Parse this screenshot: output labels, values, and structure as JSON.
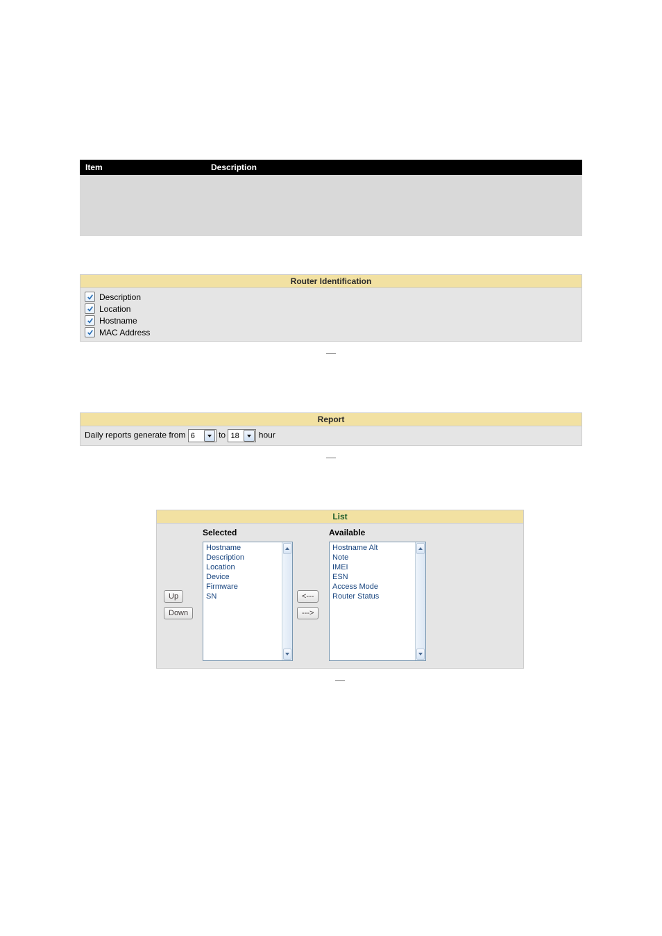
{
  "intro": {
    "headers": [
      "Item",
      "Description"
    ],
    "rows": [
      [
        "",
        ""
      ],
      [
        "",
        ""
      ],
      [
        "",
        ""
      ],
      [
        "",
        ""
      ]
    ]
  },
  "router_ident": {
    "title": "Router Identification",
    "items": [
      {
        "label": "Description",
        "checked": true
      },
      {
        "label": "Location",
        "checked": true
      },
      {
        "label": "Hostname",
        "checked": true
      },
      {
        "label": "MAC Address",
        "checked": true
      }
    ]
  },
  "separator": "—",
  "report": {
    "title": "Report",
    "prefix": "Daily reports generate from",
    "mid": "to",
    "suffix": "hour",
    "from": "6",
    "to": "18"
  },
  "list": {
    "title": "List",
    "selected_label": "Selected",
    "available_label": "Available",
    "up_btn": "Up",
    "down_btn": "Down",
    "move_left": "<---",
    "move_right": "--->",
    "selected": [
      "Hostname",
      "Description",
      "Location",
      "Device",
      "Firmware",
      "SN"
    ],
    "available": [
      "Hostname Alt",
      "Note",
      "IMEI",
      "ESN",
      "Access Mode",
      "Router Status"
    ]
  }
}
